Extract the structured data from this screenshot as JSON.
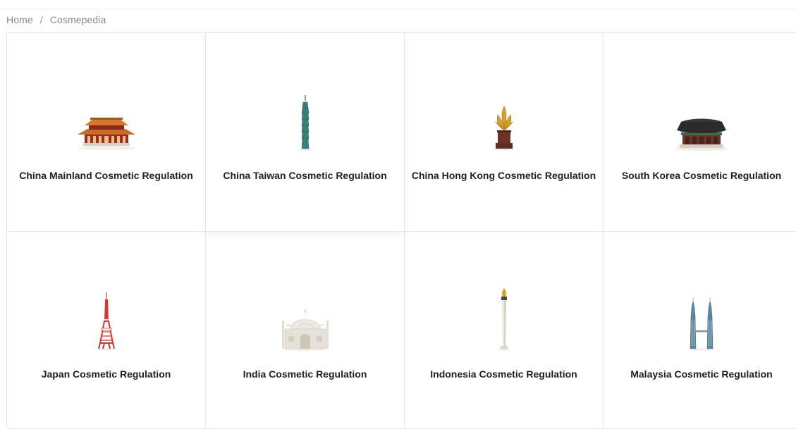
{
  "breadcrumb": {
    "home": "Home",
    "separator": "/",
    "current": "Cosmepedia"
  },
  "cards": [
    {
      "title": "China Mainland Cosmetic Regulation",
      "icon": "forbidden-city-icon"
    },
    {
      "title": "China Taiwan Cosmetic Regulation",
      "icon": "taipei-101-icon"
    },
    {
      "title": "China Hong Kong Cosmetic Regulation",
      "icon": "golden-bauhinia-icon"
    },
    {
      "title": "South Korea Cosmetic Regulation",
      "icon": "korean-palace-icon"
    },
    {
      "title": "Japan Cosmetic Regulation",
      "icon": "tokyo-tower-icon"
    },
    {
      "title": "India Cosmetic Regulation",
      "icon": "taj-mahal-icon"
    },
    {
      "title": "Indonesia Cosmetic Regulation",
      "icon": "monas-monument-icon"
    },
    {
      "title": "Malaysia Cosmetic Regulation",
      "icon": "petronas-towers-icon"
    }
  ],
  "colors": {
    "text": "#1f1f1f",
    "breadcrumb": "#8a8a8a",
    "border": "#e7e7e7"
  }
}
